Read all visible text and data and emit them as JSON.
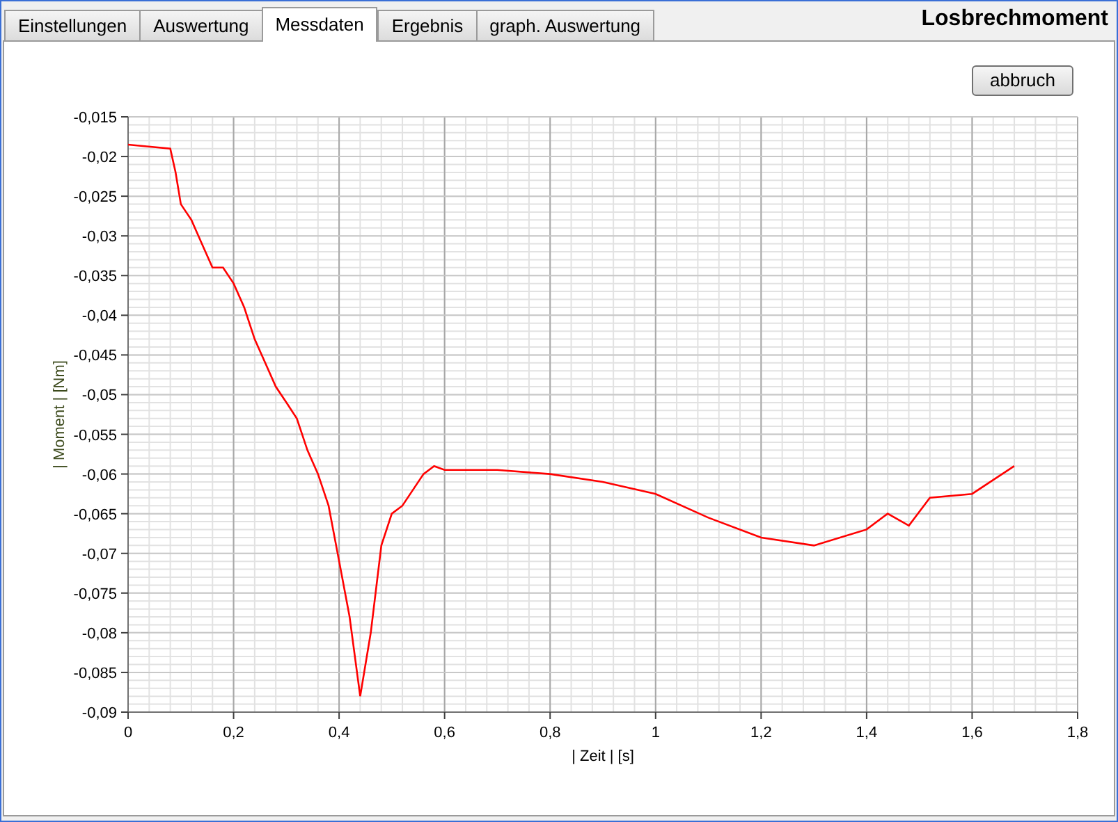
{
  "tabs": [
    {
      "label": "Einstellungen",
      "selected": false
    },
    {
      "label": "Auswertung",
      "selected": false
    },
    {
      "label": "Messdaten",
      "selected": true
    },
    {
      "label": "Ergebnis",
      "selected": false
    },
    {
      "label": "graph. Auswertung",
      "selected": false
    }
  ],
  "title": "Losbrechmoment",
  "buttons": [
    "abbruch"
  ],
  "chart": {
    "chart_data": {
      "type": "line",
      "grid": true,
      "xlabel": "| Zeit | [s]",
      "ylabel": "| Moment |  [Nm]",
      "xlim": [
        0,
        1.8
      ],
      "ylim": [
        -0.09,
        -0.015
      ],
      "xticks": [
        {
          "value": 0,
          "label": "0"
        },
        {
          "value": 0.2,
          "label": "0,2"
        },
        {
          "value": 0.4,
          "label": "0,4"
        },
        {
          "value": 0.6,
          "label": "0,6"
        },
        {
          "value": 0.8,
          "label": "0,8"
        },
        {
          "value": 1,
          "label": "1"
        },
        {
          "value": 1.2,
          "label": "1,2"
        },
        {
          "value": 1.4,
          "label": "1,4"
        },
        {
          "value": 1.6,
          "label": "1,6"
        },
        {
          "value": 1.8,
          "label": "1,8"
        }
      ],
      "yticks": [
        {
          "value": -0.015,
          "label": "-0,015"
        },
        {
          "value": -0.02,
          "label": "-0,02"
        },
        {
          "value": -0.025,
          "label": "-0,025"
        },
        {
          "value": -0.03,
          "label": "-0,03"
        },
        {
          "value": -0.035,
          "label": "-0,035"
        },
        {
          "value": -0.04,
          "label": "-0,04"
        },
        {
          "value": -0.045,
          "label": "-0,045"
        },
        {
          "value": -0.05,
          "label": "-0,05"
        },
        {
          "value": -0.055,
          "label": "-0,055"
        },
        {
          "value": -0.06,
          "label": "-0,06"
        },
        {
          "value": -0.065,
          "label": "-0,065"
        },
        {
          "value": -0.07,
          "label": "-0,07"
        },
        {
          "value": -0.075,
          "label": "-0,075"
        },
        {
          "value": -0.08,
          "label": "-0,08"
        },
        {
          "value": -0.085,
          "label": "-0,085"
        },
        {
          "value": -0.09,
          "label": "-0,09"
        }
      ],
      "x": [
        0,
        0.08,
        0.09,
        0.1,
        0.12,
        0.14,
        0.16,
        0.18,
        0.2,
        0.22,
        0.24,
        0.26,
        0.28,
        0.3,
        0.32,
        0.34,
        0.36,
        0.38,
        0.4,
        0.42,
        0.44,
        0.46,
        0.48,
        0.5,
        0.52,
        0.54,
        0.56,
        0.58,
        0.6,
        0.7,
        0.8,
        0.9,
        1.0,
        1.1,
        1.2,
        1.3,
        1.4,
        1.44,
        1.48,
        1.52,
        1.6,
        1.68
      ],
      "series": [
        {
          "color": "#ff0000",
          "values": [
            -0.0185,
            -0.019,
            -0.022,
            -0.026,
            -0.028,
            -0.031,
            -0.034,
            -0.034,
            -0.036,
            -0.039,
            -0.043,
            -0.046,
            -0.049,
            -0.051,
            -0.053,
            -0.057,
            -0.06,
            -0.064,
            -0.071,
            -0.078,
            -0.088,
            -0.08,
            -0.069,
            -0.065,
            -0.064,
            -0.062,
            -0.06,
            -0.059,
            -0.0595,
            -0.0595,
            -0.06,
            -0.061,
            -0.0625,
            -0.0655,
            -0.068,
            -0.069,
            -0.067,
            -0.065,
            -0.0665,
            -0.063,
            -0.0625,
            -0.059
          ]
        }
      ]
    }
  }
}
